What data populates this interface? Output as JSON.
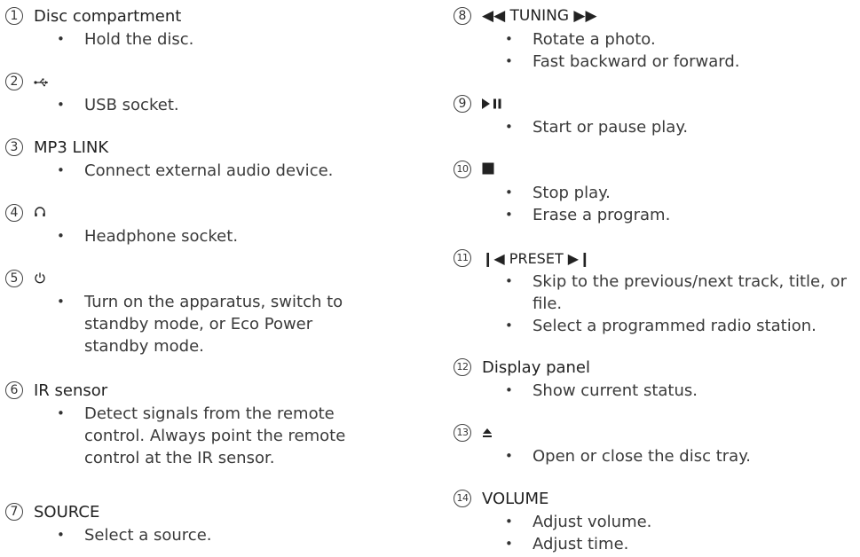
{
  "left_items": [
    {
      "num": "1",
      "title": "Disc compartment",
      "bullets": [
        "Hold the disc."
      ]
    },
    {
      "num": "2",
      "title": "⭠",
      "icon": "usb-icon",
      "bullets": [
        "USB socket."
      ]
    },
    {
      "num": "3",
      "title": "MP3 LINK",
      "bullets": [
        "Connect external audio device."
      ]
    },
    {
      "num": "4",
      "title": "∩",
      "icon": "headphone-icon",
      "bullets": [
        "Headphone socket."
      ]
    },
    {
      "num": "5",
      "title": "⏻",
      "icon": "power-icon",
      "bullets": [
        "Turn on the apparatus, switch to standby mode, or Eco Power standby mode."
      ]
    },
    {
      "num": "6",
      "title": "IR sensor",
      "bullets": [
        "Detect signals from the remote control. Always point the remote control at the IR sensor."
      ]
    },
    {
      "num": "7",
      "title": "SOURCE",
      "bullets": [
        "Select a source."
      ]
    }
  ],
  "right_items": [
    {
      "num": "8",
      "title": "◀◀ TUNING ▶▶",
      "bullets": [
        "Rotate a photo.",
        "Fast backward or forward."
      ]
    },
    {
      "num": "9",
      "title": "▶❚❚",
      "icon": "play-pause-icon",
      "bullets": [
        "Start or pause play."
      ]
    },
    {
      "num": "10",
      "title": "■",
      "icon": "stop-icon",
      "bullets": [
        "Stop play.",
        "Erase a program."
      ]
    },
    {
      "num": "11",
      "title": "❙◀ PRESET ▶❙",
      "bullets": [
        "Skip to the previous/next track, title, or file.",
        "Select a programmed radio station."
      ]
    },
    {
      "num": "12",
      "title": "Display panel",
      "bullets": [
        "Show current status."
      ]
    },
    {
      "num": "13",
      "title": "▲",
      "icon": "eject-icon",
      "bullets": [
        "Open or close the disc tray."
      ]
    },
    {
      "num": "14",
      "title": "VOLUME",
      "bullets": [
        "Adjust volume.",
        "Adjust time."
      ]
    }
  ],
  "bullet_char": "•"
}
